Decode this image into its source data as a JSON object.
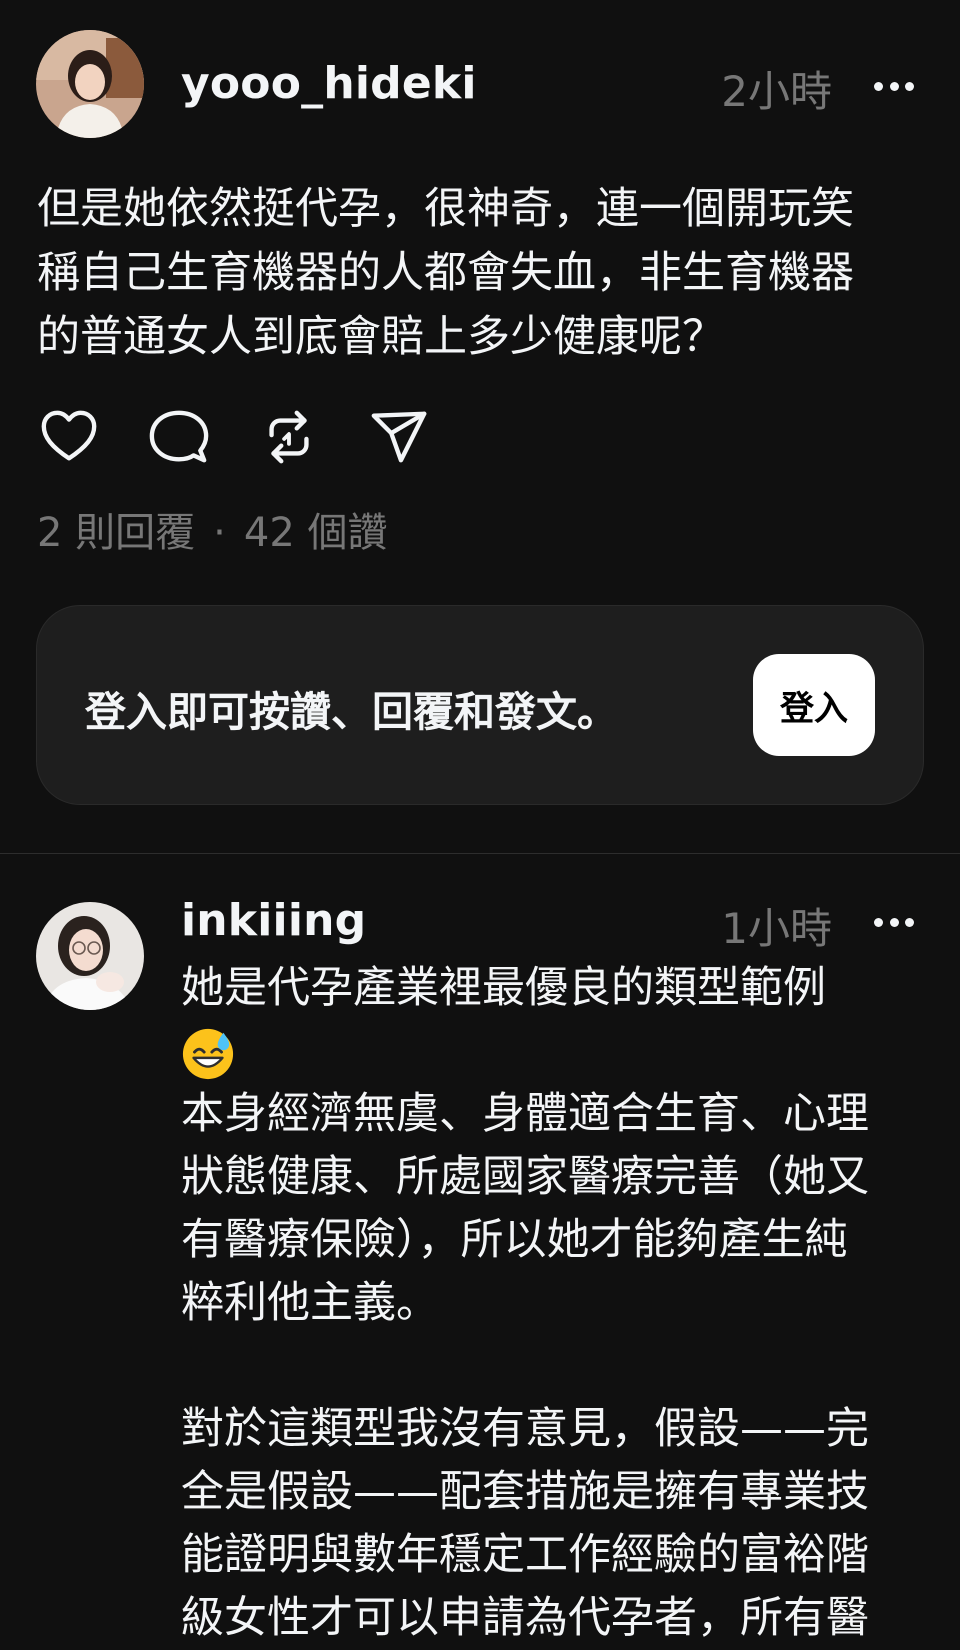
{
  "post": {
    "username": "yooo_hideki",
    "time": "2小時",
    "text": "但是她依然挺代孕，很神奇，連一個開玩笑\n稱自己生育機器的人都會失血，非生育機器\n的普通女人到底會賠上多少健康呢？",
    "actions": [
      "heart-icon",
      "comment-icon",
      "repost-icon",
      "share-icon"
    ],
    "stats": {
      "replies": "2 則回覆",
      "separator": "·",
      "likes": "42 個讚"
    }
  },
  "login_prompt": {
    "text": "登入即可按讚、回覆和發文。",
    "button_label": "登入"
  },
  "reply": {
    "username": "inkiiing",
    "time": "1小時",
    "line1": "她是代孕產業裡最優良的類型範例",
    "emoji": "😅",
    "paragraph1": "本身經濟無虞、身體適合生育、心理\n狀態健康、所處國家醫療完善（她又\n有醫療保險），所以她才能夠產生純\n粹利他主義。",
    "paragraph2": "對於這類型我沒有意見，假設——完\n全是假設——配套措施是擁有專業技\n能證明與數年穩定工作經驗的富裕階\n級女性才可以申請為代孕者，所有醫"
  },
  "colors": {
    "background": "#101010",
    "text": "#f3f5f7",
    "secondary": "#777777",
    "card": "#1e1e1e"
  }
}
